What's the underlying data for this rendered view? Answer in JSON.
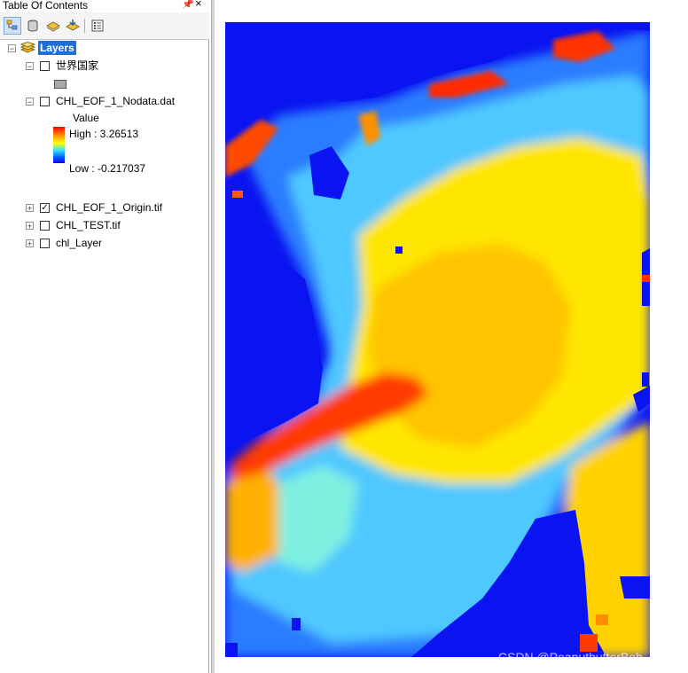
{
  "toc": {
    "title": "Table Of Contents",
    "pin_icon": "pin-icon",
    "close_icon": "close-icon",
    "toolbar": [
      "list-by-drawing-order-icon",
      "list-by-source-icon",
      "list-by-visibility-icon",
      "list-by-selection-icon",
      "options-icon"
    ],
    "layers_label": "Layers",
    "items": [
      {
        "label": "世界国家",
        "checked": false
      },
      {
        "label": "CHL_EOF_1_Nodata.dat",
        "checked": false
      },
      {
        "label": "CHL_EOF_1_Origin.tif",
        "checked": true
      },
      {
        "label": "CHL_TEST.tif",
        "checked": false
      },
      {
        "label": "chl_Layer",
        "checked": false
      }
    ],
    "legend": {
      "heading": "Value",
      "high": "High : 3.26513",
      "low": "Low : -0.217037"
    }
  },
  "map": {
    "layer": "CHL_EOF_1_Origin.tif",
    "colors": {
      "nodata": "#0a14f0",
      "red": "#ff2a00",
      "orange": "#ff8a00",
      "yellow": "#ffee00",
      "cyan": "#40e0ff",
      "blue": "#1080ff"
    }
  },
  "watermark": "CSDN @PeanutbutterBoh"
}
